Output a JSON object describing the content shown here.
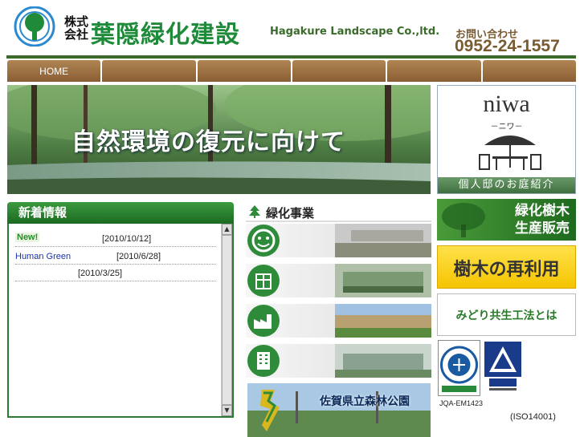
{
  "header": {
    "kabu_line1": "株式",
    "kabu_line2": "会社",
    "company_name": "葉隠緑化建設",
    "company_name_en": "Hagakure Landscape Co.,ltd.",
    "contact_label": "お問い合わせ",
    "contact_phone": "0952-24-1557"
  },
  "nav": {
    "items": [
      {
        "label": "HOME"
      },
      {
        "label": ""
      },
      {
        "label": ""
      },
      {
        "label": ""
      },
      {
        "label": ""
      },
      {
        "label": ""
      }
    ]
  },
  "hero": {
    "text": "自然環境の復元に向けて"
  },
  "niwa": {
    "title": "niwa",
    "subtitle": "－ニワ－",
    "footer": "個人邸のお庭紹介"
  },
  "news": {
    "title": "新着情報",
    "items": [
      {
        "badge": "New!",
        "text": "",
        "date": "[2010/10/12]"
      },
      {
        "badge": "",
        "text": "Human Green",
        "date": "[2010/6/28]"
      },
      {
        "badge": "",
        "text": "",
        "date": "[2010/3/25]"
      }
    ]
  },
  "ryokuka": {
    "title": "緑化事業",
    "park_banner": "佐賀県立森林公園"
  },
  "banners": {
    "ryokuju_line1": "緑化樹木",
    "ryokuju_line2": "生産販売",
    "reuse": "樹木の再利用",
    "midori": "みどり共生工法とは"
  },
  "certs": {
    "jqa_code": "JQA-EM1423",
    "iso": "(ISO14001)"
  },
  "colors": {
    "brand_green": "#1e8a3a",
    "nav_brown": "#9a6e42",
    "contact_brown": "#7a5a30"
  }
}
